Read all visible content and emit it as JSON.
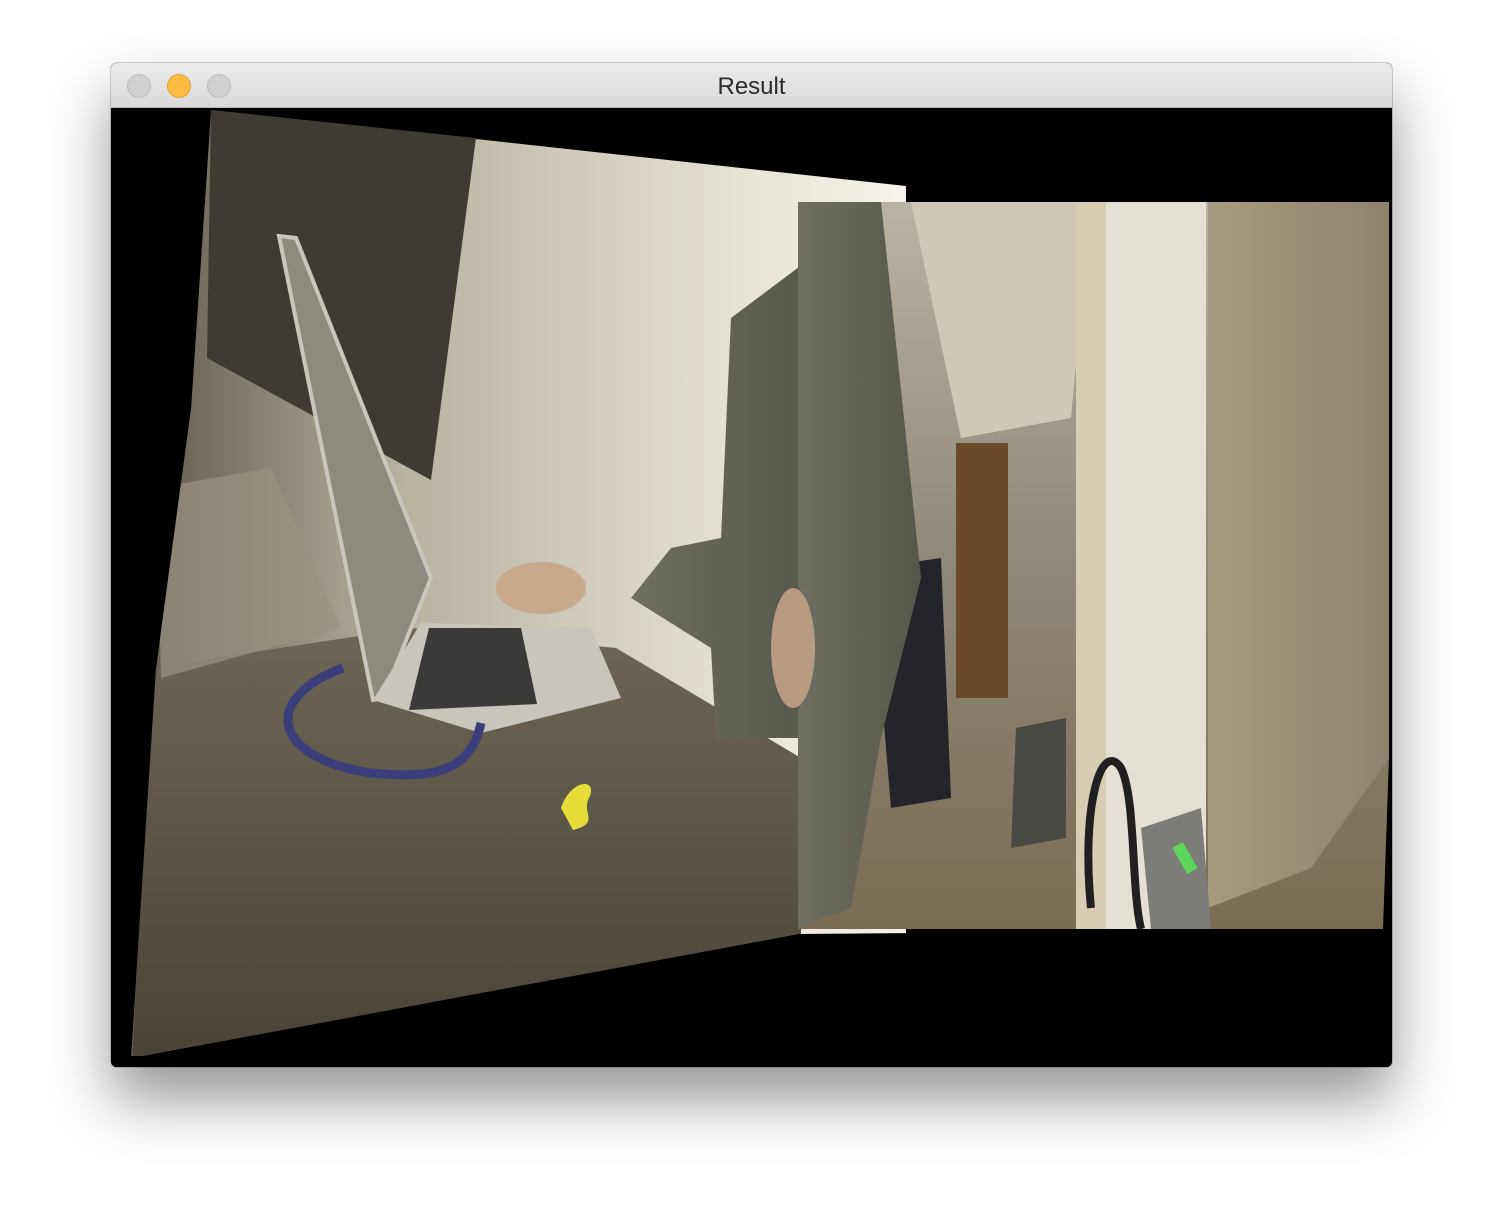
{
  "window": {
    "title": "Result",
    "buttons": {
      "close": "close-button",
      "minimize": "minimize-button",
      "zoom": "zoom-button"
    },
    "accent_colors": {
      "close": "#d0d0d0",
      "minimize": "#fdbc40",
      "zoom": "#d0d0d0"
    }
  },
  "canvas": {
    "description_icon": "stitched-panorama-image",
    "background": "#000000"
  }
}
